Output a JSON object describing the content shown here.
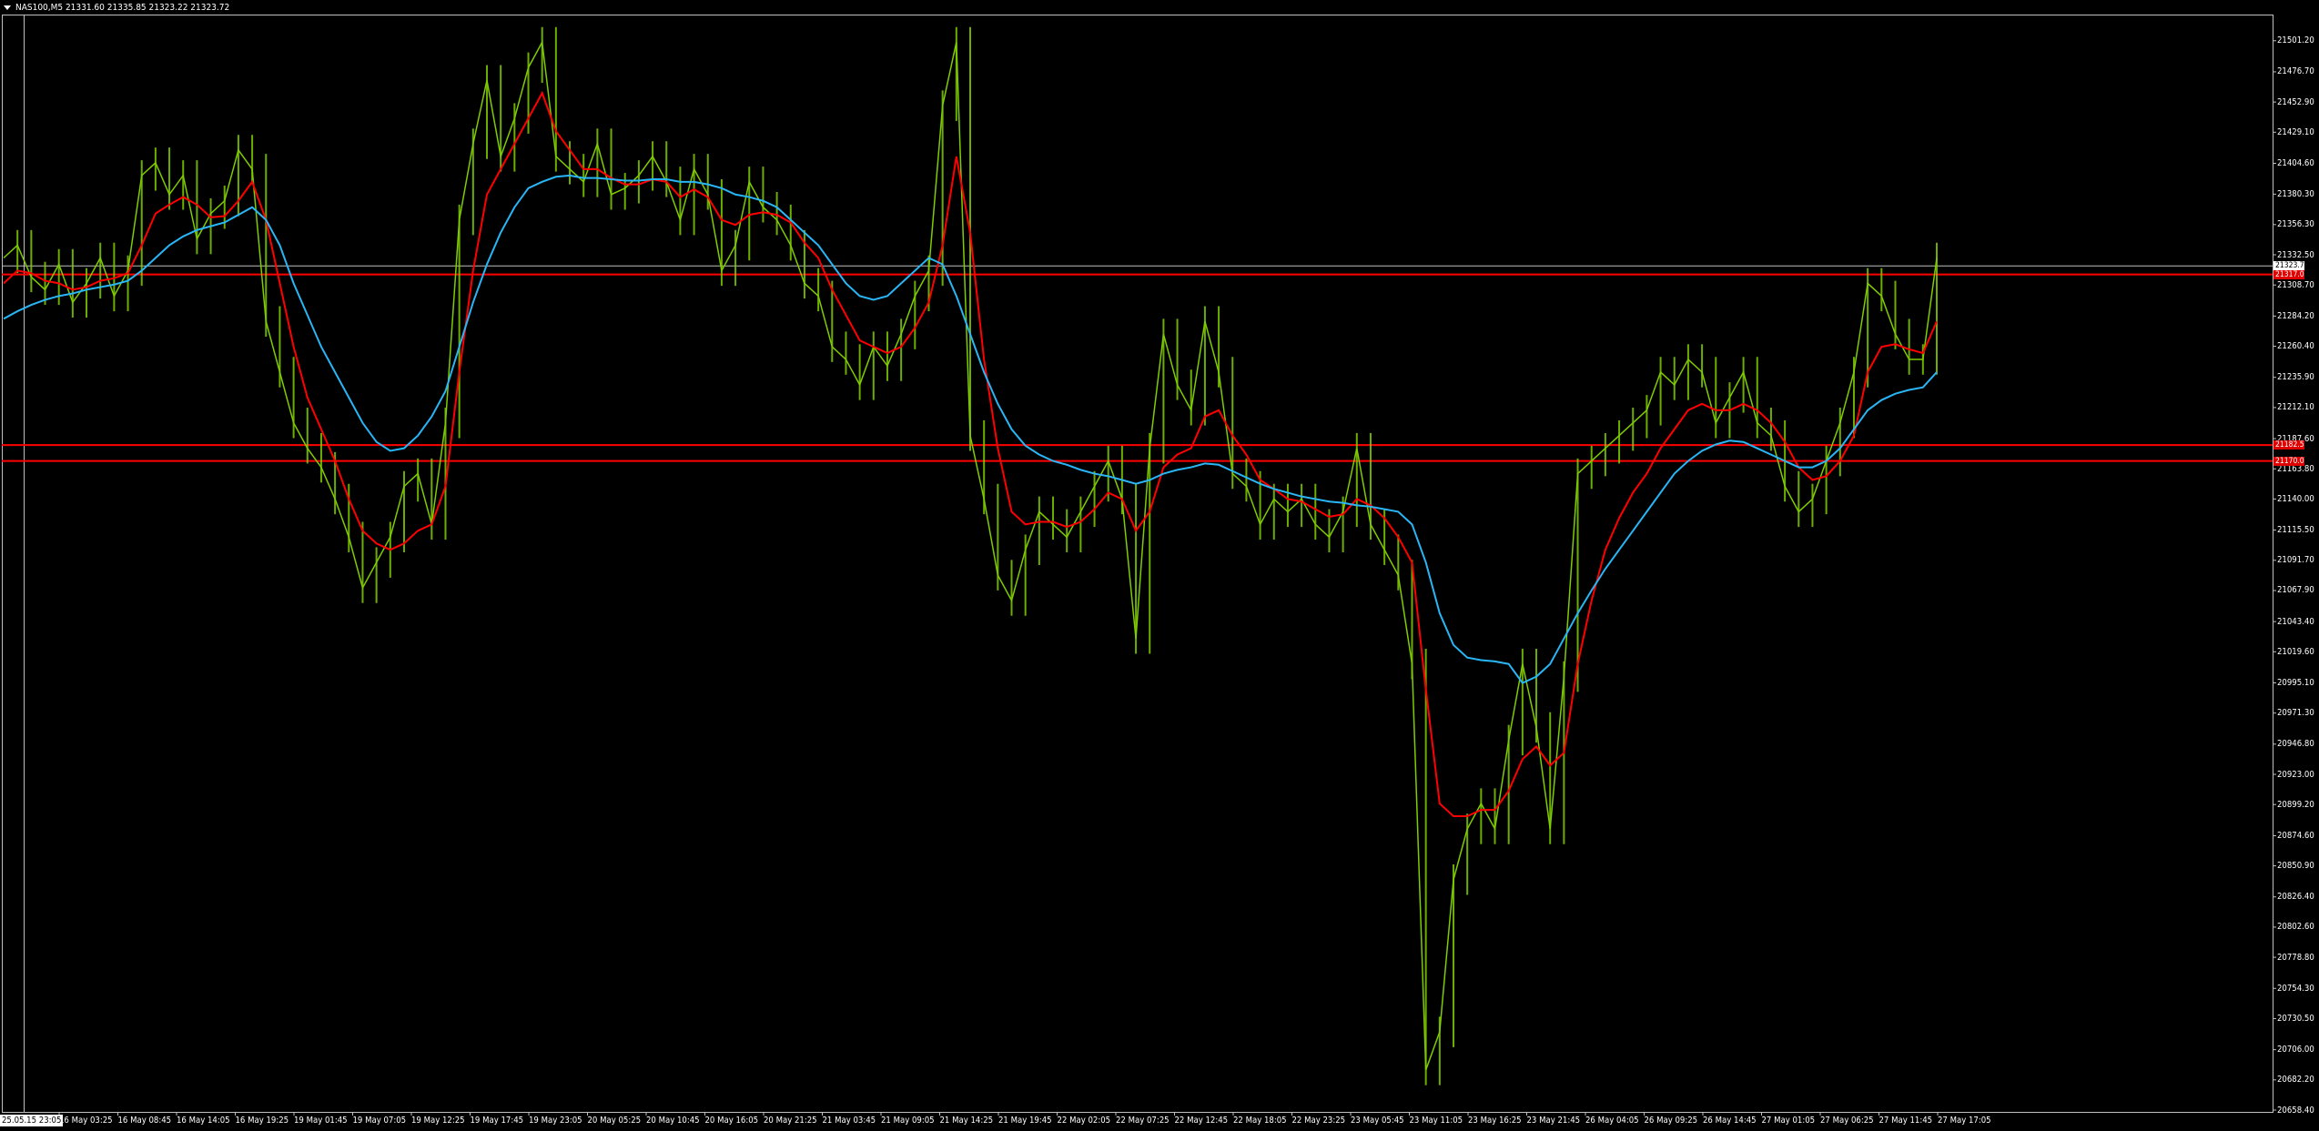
{
  "window": {
    "symbol_line": "NAS100,M5  21331.60 21335.85 21323.22 21323.72",
    "current_price_tag": "21323.72"
  },
  "chart_data": {
    "type": "line",
    "title": "NAS100,M5",
    "ohlc_last": {
      "open": 21331.6,
      "high": 21335.85,
      "low": 21323.22,
      "close": 21323.72
    },
    "ylim": [
      20658.4,
      21520.4
    ],
    "y_ticks": [
      "21501.20",
      "21476.70",
      "21452.90",
      "21429.10",
      "21404.60",
      "21380.30",
      "21356.30",
      "21332.50",
      "21308.70",
      "21284.20",
      "21260.40",
      "21235.90",
      "21212.10",
      "21187.60",
      "21163.80",
      "21140.00",
      "21115.50",
      "21091.70",
      "21067.90",
      "21043.40",
      "21019.60",
      "20995.10",
      "20971.30",
      "20946.80",
      "20923.00",
      "20899.20",
      "20874.60",
      "20850.90",
      "20826.40",
      "20802.60",
      "20778.80",
      "20754.30",
      "20730.50",
      "20706.00",
      "20682.20",
      "20658.40"
    ],
    "x_ticks": [
      "25.05.15 23:05",
      "16 May 03:25",
      "16 May 08:45",
      "16 May 14:05",
      "16 May 19:25",
      "19 May 01:45",
      "19 May 07:05",
      "19 May 12:25",
      "19 May 17:45",
      "19 May 23:05",
      "20 May 05:25",
      "20 May 10:45",
      "20 May 16:05",
      "20 May 21:25",
      "21 May 03:45",
      "21 May 09:05",
      "21 May 14:25",
      "21 May 19:45",
      "22 May 02:05",
      "22 May 07:25",
      "22 May 12:45",
      "22 May 18:05",
      "22 May 23:25",
      "23 May 05:45",
      "23 May 11:05",
      "23 May 16:25",
      "23 May 21:45",
      "26 May 04:05",
      "26 May 09:25",
      "26 May 14:45",
      "27 May 01:05",
      "27 May 06:25",
      "27 May 11:45",
      "27 May 17:05"
    ],
    "x_label_separator": "16 May 03:25",
    "horizontal_levels": [
      {
        "price": 21317.0,
        "color": "#ff0000",
        "tag": "21317.00"
      },
      {
        "price": 21182.5,
        "color": "#ff0000",
        "tag": "21182.50"
      },
      {
        "price": 21170.0,
        "color": "#ff0000",
        "tag": "21170.00"
      },
      {
        "price": 21323.72,
        "color": "#c0c0c0",
        "tag": "21323.72"
      }
    ],
    "series": [
      {
        "role": "price",
        "color": "#7fcc00",
        "values": [
          21330,
          21340,
          21315,
          21305,
          21325,
          21295,
          21310,
          21330,
          21300,
          21320,
          21395,
          21405,
          21380,
          21395,
          21345,
          21365,
          21375,
          21415,
          21400,
          21280,
          21240,
          21200,
          21180,
          21165,
          21140,
          21110,
          21070,
          21090,
          21110,
          21150,
          21160,
          21120,
          21200,
          21360,
          21420,
          21470,
          21410,
          21440,
          21480,
          21500,
          21410,
          21400,
          21390,
          21420,
          21380,
          21385,
          21395,
          21410,
          21390,
          21360,
          21400,
          21380,
          21320,
          21340,
          21390,
          21370,
          21360,
          21340,
          21310,
          21300,
          21260,
          21250,
          21230,
          21260,
          21245,
          21270,
          21300,
          21320,
          21450,
          21500,
          21190,
          21140,
          21080,
          21060,
          21100,
          21130,
          21120,
          21110,
          21130,
          21150,
          21170,
          21140,
          21030,
          21180,
          21270,
          21230,
          21210,
          21280,
          21240,
          21160,
          21150,
          21120,
          21140,
          21130,
          21140,
          21120,
          21110,
          21130,
          21180,
          21120,
          21100,
          21080,
          21010,
          20690,
          20720,
          20840,
          20880,
          20900,
          20880,
          20950,
          21010,
          20960,
          20880,
          21000,
          21160,
          21170,
          21180,
          21190,
          21200,
          21210,
          21240,
          21230,
          21250,
          21240,
          21200,
          21220,
          21240,
          21200,
          21190,
          21150,
          21130,
          21140,
          21170,
          21200,
          21240,
          21310,
          21300,
          21270,
          21250,
          21250,
          21330
        ]
      },
      {
        "role": "fast MA",
        "color": "#ff0000",
        "values": [
          21310,
          21320,
          21318,
          21312,
          21310,
          21305,
          21307,
          21312,
          21314,
          21318,
          21340,
          21365,
          21372,
          21378,
          21372,
          21362,
          21363,
          21375,
          21390,
          21360,
          21310,
          21260,
          21220,
          21195,
          21170,
          21140,
          21115,
          21105,
          21100,
          21105,
          21115,
          21120,
          21150,
          21240,
          21320,
          21380,
          21400,
          21420,
          21440,
          21460,
          21430,
          21415,
          21400,
          21400,
          21393,
          21388,
          21388,
          21392,
          21390,
          21378,
          21384,
          21378,
          21360,
          21356,
          21364,
          21366,
          21364,
          21358,
          21342,
          21330,
          21305,
          21285,
          21265,
          21260,
          21255,
          21260,
          21275,
          21295,
          21340,
          21410,
          21350,
          21250,
          21180,
          21130,
          21120,
          21122,
          21122,
          21118,
          21122,
          21132,
          21145,
          21140,
          21115,
          21130,
          21165,
          21175,
          21180,
          21205,
          21210,
          21190,
          21175,
          21155,
          21148,
          21140,
          21138,
          21132,
          21126,
          21128,
          21140,
          21135,
          21125,
          21110,
          21090,
          20990,
          20900,
          20890,
          20890,
          20895,
          20895,
          20910,
          20935,
          20945,
          20930,
          20940,
          21010,
          21060,
          21100,
          21125,
          21145,
          21160,
          21180,
          21195,
          21210,
          21215,
          21210,
          21210,
          21215,
          21210,
          21200,
          21185,
          21165,
          21155,
          21158,
          21170,
          21190,
          21240,
          21260,
          21262,
          21258,
          21255,
          21280
        ]
      },
      {
        "role": "slow MA",
        "color": "#29b6f6",
        "values": [
          21282,
          21288,
          21293,
          21297,
          21300,
          21302,
          21305,
          21307,
          21309,
          21312,
          21320,
          21330,
          21340,
          21347,
          21352,
          21355,
          21358,
          21364,
          21370,
          21360,
          21340,
          21310,
          21285,
          21260,
          21240,
          21220,
          21200,
          21185,
          21178,
          21180,
          21190,
          21205,
          21225,
          21260,
          21295,
          21325,
          21350,
          21370,
          21385,
          21390,
          21394,
          21395,
          21393,
          21393,
          21392,
          21391,
          21391,
          21392,
          21392,
          21390,
          21390,
          21388,
          21385,
          21380,
          21378,
          21375,
          21370,
          21360,
          21350,
          21340,
          21325,
          21310,
          21300,
          21297,
          21300,
          21310,
          21320,
          21330,
          21325,
          21300,
          21270,
          21240,
          21215,
          21195,
          21182,
          21175,
          21170,
          21167,
          21163,
          21160,
          21158,
          21155,
          21152,
          21155,
          21160,
          21163,
          21165,
          21168,
          21167,
          21162,
          21157,
          21152,
          21148,
          21145,
          21142,
          21140,
          21138,
          21137,
          21135,
          21134,
          21132,
          21130,
          21120,
          21090,
          21050,
          21025,
          21015,
          21013,
          21012,
          21010,
          20995,
          21000,
          21010,
          21030,
          21050,
          21068,
          21085,
          21100,
          21115,
          21130,
          21145,
          21160,
          21170,
          21178,
          21183,
          21186,
          21185,
          21180,
          21175,
          21170,
          21165,
          21165,
          21170,
          21180,
          21195,
          21210,
          21218,
          21223,
          21226,
          21228,
          21240
        ]
      }
    ]
  }
}
